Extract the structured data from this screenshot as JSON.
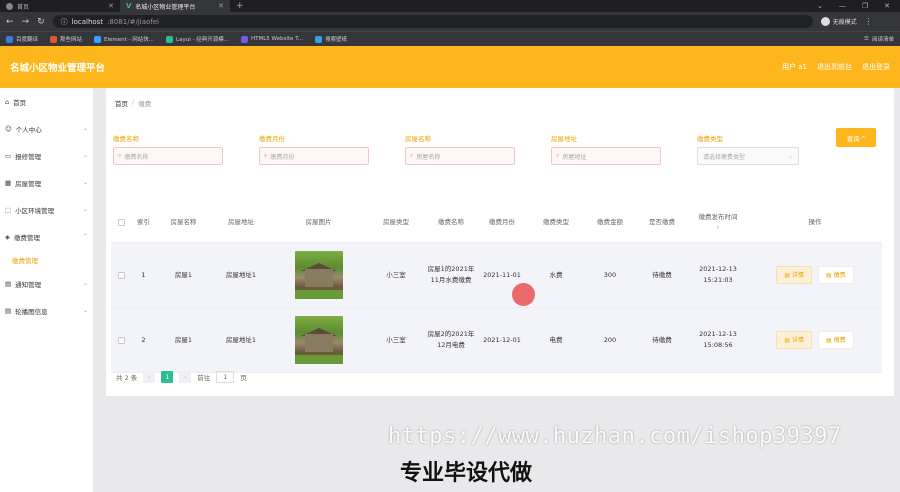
{
  "browser": {
    "tabs": [
      {
        "title": "首页",
        "active": false
      },
      {
        "title": "名城小区物业管理平台",
        "active": true
      }
    ],
    "url_host": "localhost",
    "url_path": ":8081/#/jiaofei",
    "profile_label": "无痕模式",
    "bookmarks": [
      "百度翻译",
      "那些网站",
      "Element - 网站快...",
      "Layui - 经典开源模...",
      "HTML5 Website T...",
      "搜索壁纸"
    ],
    "bookmarks_right": "阅读清单"
  },
  "header": {
    "title": "名城小区物业管理平台",
    "user": "用户 a1",
    "back_to_front": "退出到前台",
    "logout": "退出登录"
  },
  "sidebar": {
    "items": [
      {
        "label": "首页"
      },
      {
        "label": "个人中心"
      },
      {
        "label": "报修管理"
      },
      {
        "label": "房屋管理"
      },
      {
        "label": "小区环境管理"
      },
      {
        "label": "缴费管理"
      },
      {
        "label": "通知管理"
      },
      {
        "label": "轮播图信息"
      }
    ],
    "sub_active": "缴费管理"
  },
  "breadcrumb": {
    "home": "首页",
    "current": "缴费"
  },
  "search": {
    "fee_name_label": "缴费名称",
    "fee_name_placeholder": "缴费名称",
    "fee_month_label": "缴费月份",
    "fee_month_placeholder": "缴费月份",
    "house_name_label": "房屋名称",
    "house_name_placeholder": "房屋名称",
    "house_addr_label": "房屋地址",
    "house_addr_placeholder": "房屋地址",
    "fee_type_label": "缴费类型",
    "fee_type_placeholder": "请选择缴费类型",
    "query_label": "查询"
  },
  "table": {
    "headers": {
      "index": "索引",
      "house_name": "房屋名称",
      "house_addr": "房屋地址",
      "house_img": "房屋图片",
      "house_type": "房屋类型",
      "fee_name": "缴费名称",
      "fee_month": "缴费月份",
      "fee_type": "缴费类型",
      "fee_amount": "缴费金额",
      "is_paid": "是否缴费",
      "publish_time": "缴费发布时间",
      "ops": "操作"
    },
    "rows": [
      {
        "index": "1",
        "house_name": "房屋1",
        "house_addr": "房屋地址1",
        "house_type": "小三室",
        "fee_name": "房屋1的2021年11月水费缴费",
        "fee_month": "2021-11-01",
        "fee_type": "水费",
        "fee_amount": "300",
        "is_paid": "待缴费",
        "publish_time": "2021-12-13 15:21:03",
        "detail_label": "详情",
        "pay_label": "缴费"
      },
      {
        "index": "2",
        "house_name": "房屋1",
        "house_addr": "房屋地址1",
        "house_type": "小三室",
        "fee_name": "房屋2的2021年12月电费",
        "fee_month": "2021-12-01",
        "fee_type": "电费",
        "fee_amount": "200",
        "is_paid": "待缴费",
        "publish_time": "2021-12-13 15:08:56",
        "detail_label": "详情",
        "pay_label": "缴费"
      }
    ]
  },
  "pagination": {
    "total": "共 2 条",
    "current_page": "1",
    "goto_prefix": "前往",
    "goto_value": "1",
    "goto_suffix": "页"
  },
  "watermark": {
    "url": "https://www.huzhan.com/ishop39397",
    "text": "专业毕设代做"
  },
  "colors": {
    "accent": "#fdb71c",
    "pager_active": "#2dbd91",
    "label": "#e8a400"
  }
}
